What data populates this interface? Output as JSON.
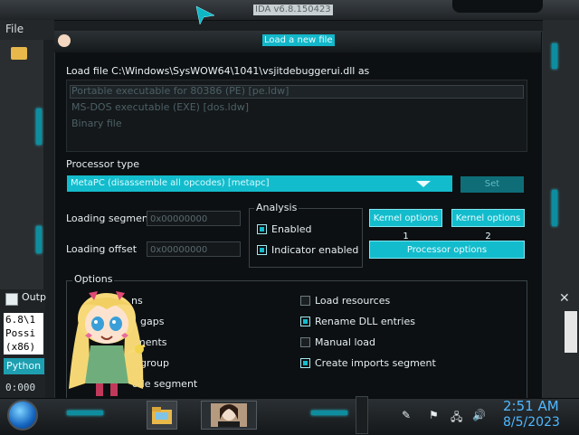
{
  "app": {
    "title": "IDA v6.8.150423",
    "menu_file": "File"
  },
  "dialog": {
    "title": "Load a new file",
    "load_file_label": "Load file C:\\Windows\\SysWOW64\\1041\\vsjitdebuggerui.dll as",
    "formats": [
      "Portable executable for 80386 (PE) [pe.ldw]",
      "MS-DOS executable (EXE) [dos.ldw]",
      "Binary file"
    ],
    "processor_type_label": "Processor type",
    "processor_value": "MetaPC (disassemble all opcodes) [metapc]",
    "set_button": "Set",
    "loading_segment_label": "Loading segment",
    "loading_segment_value": "0x00000000",
    "loading_offset_label": "Loading offset",
    "loading_offset_value": "0x00000000",
    "analysis_label": "Analysis",
    "analysis_enabled": "Enabled",
    "analysis_indicator": "Indicator enabled",
    "kernel_options_1": "Kernel options 1",
    "kernel_options_2": "Kernel options 2",
    "processor_options": "Processor options",
    "options_label": "Options",
    "options_left": [
      {
        "label": "Fill segment gaps"
      },
      {
        "label": "Create segments"
      },
      {
        "label": "Create FLAT group"
      },
      {
        "label": "Load as code segment"
      }
    ],
    "options_left_visible": [
      "ns",
      "gaps",
      "ments",
      "group",
      "ode segment"
    ],
    "options_right": [
      {
        "label": "Load resources",
        "checked": false
      },
      {
        "label": "Rename DLL entries",
        "checked": true
      },
      {
        "label": "Manual load",
        "checked": false
      },
      {
        "label": "Create imports segment",
        "checked": true
      }
    ]
  },
  "output": {
    "tab_label": "Outp",
    "console_lines": [
      "6.8\\1",
      "Possi",
      "(x86)"
    ],
    "python_button": "Python",
    "status": "0:000"
  },
  "taskbar": {
    "time": "2:51 AM",
    "date": "8/5/2023"
  },
  "colors": {
    "accent": "#13bccc",
    "background": "#0d1012",
    "clock": "#4fb8ff"
  }
}
